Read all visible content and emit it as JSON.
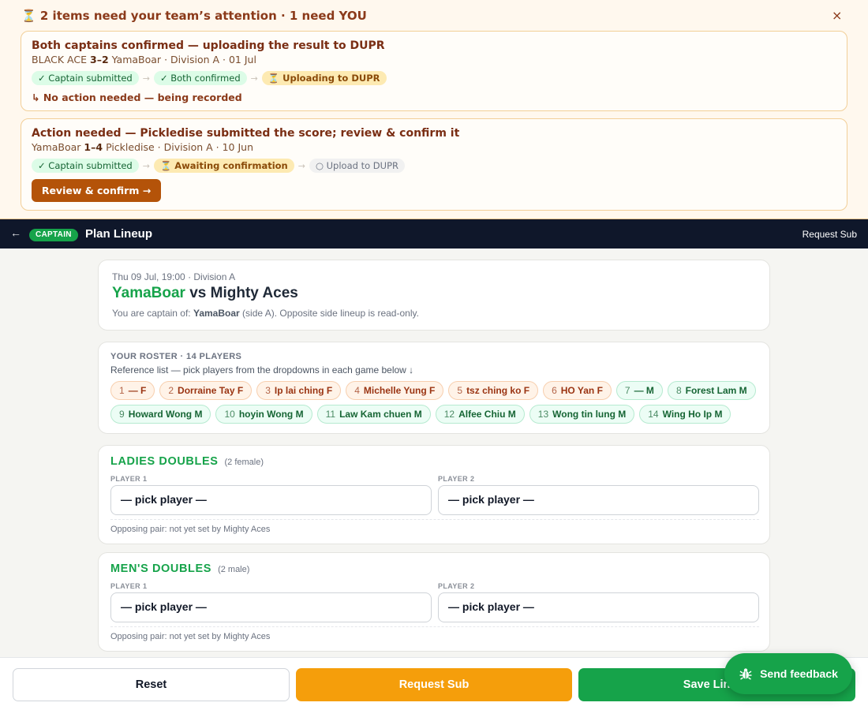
{
  "banner": {
    "title": "⏳ 2 items need your team’s attention · 1 need YOU",
    "close": "×",
    "notices": [
      {
        "title": "Both captains confirmed — uploading the result to DUPR",
        "team_a": "BLACK ACE",
        "score": "3–2",
        "team_b": "YamaBoar",
        "meta": "· Division A · 01 Jul",
        "steps": [
          "✓ Captain submitted",
          "✓ Both confirmed",
          "⏳ Uploading to DUPR"
        ],
        "note": "↳ No action needed — being recorded"
      },
      {
        "title": "Action needed — Pickledise submitted the score; review & confirm it",
        "team_a": "YamaBoar",
        "score": "1–4",
        "team_b": "Pickledise",
        "meta": "· Division A · 10 Jun",
        "steps": [
          "✓ Captain submitted",
          "⏳ Awaiting confirmation",
          "○ Upload to DUPR"
        ],
        "button": "Review & confirm →"
      }
    ],
    "step_arrow": "→"
  },
  "header": {
    "back": "←",
    "role": "CAPTAIN",
    "title": "Plan Lineup",
    "request_sub": "Request Sub"
  },
  "match": {
    "meta": "Thu 09 Jul, 19:00 · Division A",
    "home": "YamaBoar",
    "vs": "vs",
    "away": "Mighty Aces",
    "note_prefix": "You are captain of:",
    "note_team": "YamaBoar",
    "note_suffix": "(side A). Opposite side lineup is read-only."
  },
  "roster": {
    "heading": "YOUR ROSTER · 14 PLAYERS",
    "reference": "Reference list — pick players from the dropdowns in each game below ↓",
    "players": [
      {
        "num": "1",
        "name": "— F",
        "g": "F"
      },
      {
        "num": "2",
        "name": "Dorraine Tay F",
        "g": "F"
      },
      {
        "num": "3",
        "name": "Ip lai ching F",
        "g": "F"
      },
      {
        "num": "4",
        "name": "Michelle Yung F",
        "g": "F"
      },
      {
        "num": "5",
        "name": "tsz ching ko F",
        "g": "F"
      },
      {
        "num": "6",
        "name": "HO Yan F",
        "g": "F"
      },
      {
        "num": "7",
        "name": "— M",
        "g": "M"
      },
      {
        "num": "8",
        "name": "Forest Lam M",
        "g": "M"
      },
      {
        "num": "9",
        "name": "Howard Wong M",
        "g": "M"
      },
      {
        "num": "10",
        "name": "hoyin Wong M",
        "g": "M"
      },
      {
        "num": "11",
        "name": "Law Kam chuen M",
        "g": "M"
      },
      {
        "num": "12",
        "name": "Alfee Chiu M",
        "g": "M"
      },
      {
        "num": "13",
        "name": "Wong tin lung M",
        "g": "M"
      },
      {
        "num": "14",
        "name": "Wing Ho Ip M",
        "g": "M"
      }
    ]
  },
  "games": [
    {
      "title": "LADIES DOUBLES",
      "requirement": "(2 female)",
      "player1_label": "PLAYER 1",
      "player2_label": "PLAYER 2",
      "player1": "— pick player —",
      "player2": "— pick player —",
      "opposing": "Opposing pair: not yet set by Mighty Aces"
    },
    {
      "title": "MEN'S DOUBLES",
      "requirement": "(2 male)",
      "player1_label": "PLAYER 1",
      "player2_label": "PLAYER 2",
      "player1": "— pick player —",
      "player2": "— pick player —",
      "opposing": "Opposing pair: not yet set by Mighty Aces"
    }
  ],
  "footer": {
    "reset": "Reset",
    "request_sub": "Request Sub",
    "save": "Save Lineup"
  },
  "feedback": {
    "label": "Send feedback",
    "icon": "bug-icon"
  },
  "colors": {
    "accent_green": "#16a34a",
    "warn_amber": "#f59e0b",
    "banner_brown": "#8b3a1a",
    "header_navy": "#0f172a"
  }
}
